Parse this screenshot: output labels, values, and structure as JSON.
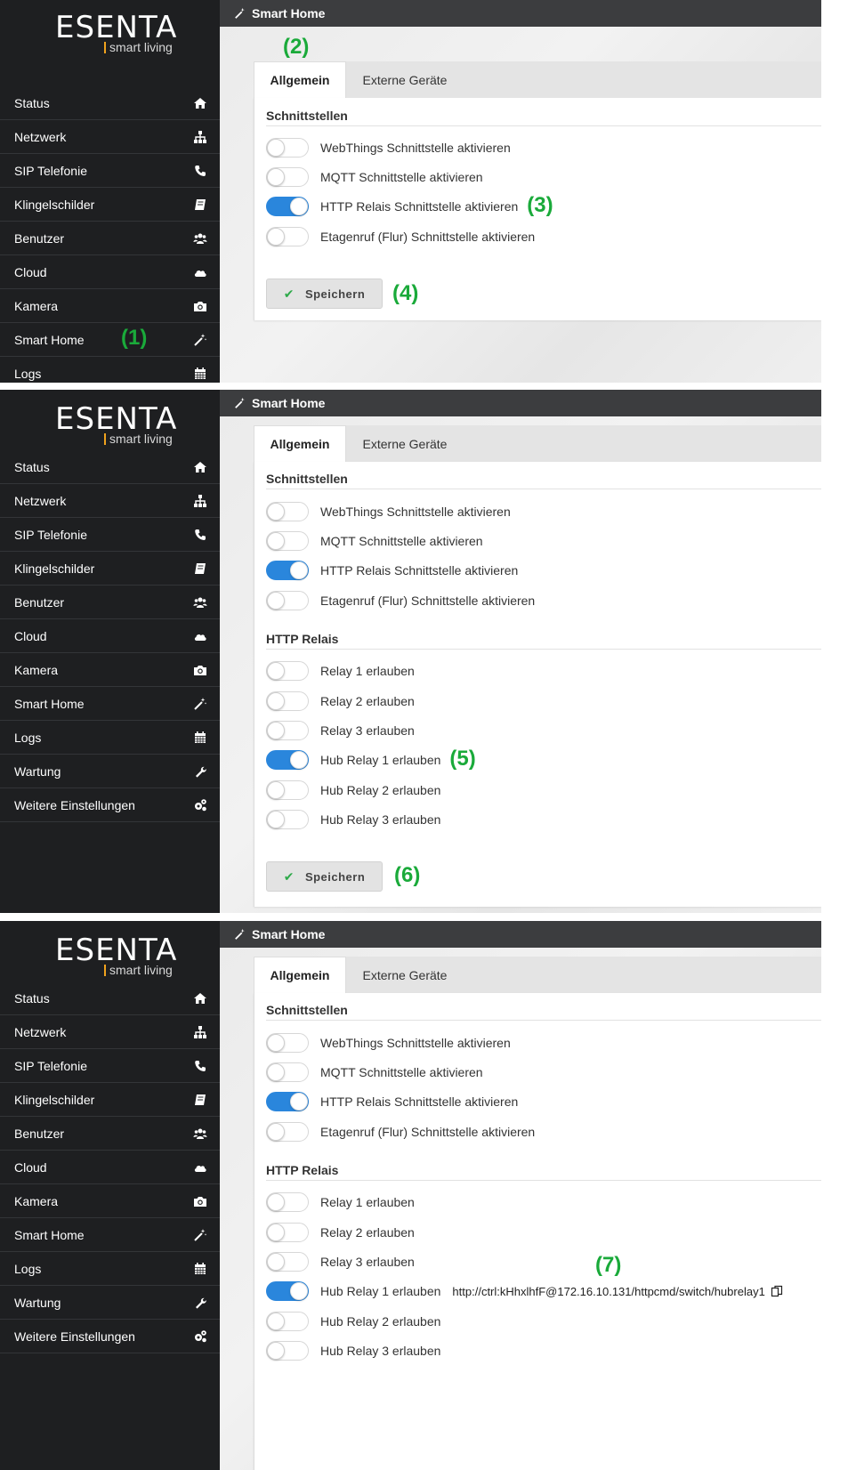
{
  "brand": {
    "name": "ESENTA",
    "tagline": "smart living"
  },
  "header": {
    "title": "Smart Home"
  },
  "tabs": {
    "general": "Allgemein",
    "external": "Externe Geräte"
  },
  "sections": {
    "interfaces": "Schnittstellen",
    "http_relay": "HTTP Relais"
  },
  "nav": {
    "status": "Status",
    "network": "Netzwerk",
    "sip": "SIP Telefonie",
    "doorbell": "Klingelschilder",
    "users": "Benutzer",
    "cloud": "Cloud",
    "camera": "Kamera",
    "smarthome": "Smart Home",
    "logs": "Logs",
    "maintenance": "Wartung",
    "more": "Weitere Einstellungen"
  },
  "interfaces": {
    "webthings": "WebThings Schnittstelle aktivieren",
    "mqtt": "MQTT Schnittstelle aktivieren",
    "http": "HTTP Relais Schnittstelle aktivieren",
    "floor": "Etagenruf (Flur) Schnittstelle aktivieren"
  },
  "relays": {
    "r1": "Relay 1 erlauben",
    "r2": "Relay 2 erlauben",
    "r3": "Relay 3 erlauben",
    "h1": "Hub Relay 1 erlauben",
    "h2": "Hub Relay 2 erlauben",
    "h3": "Hub Relay 3 erlauben"
  },
  "save_label": "Speichern",
  "relay_url": "http://ctrl:kHhxlhfF@172.16.10.131/httpcmd/switch/hubrelay1",
  "annotations": {
    "a1": "(1)",
    "a2": "(2)",
    "a3": "(3)",
    "a4": "(4)",
    "a5": "(5)",
    "a6": "(6)",
    "a7": "(7)"
  },
  "colors": {
    "accent": "#2a86dc",
    "annotation": "#1aaa3a",
    "sidebar": "#1e1f21",
    "topbar": "#3c3d3f"
  },
  "icons": {
    "status": "home-icon",
    "network": "sitemap-icon",
    "sip": "phone-icon",
    "doorbell": "book-icon",
    "users": "users-icon",
    "cloud": "cloud-icon",
    "camera": "camera-icon",
    "smarthome": "magic-wand-icon",
    "logs": "calendar-icon",
    "maintenance": "wrench-icon",
    "more": "cogs-icon"
  }
}
